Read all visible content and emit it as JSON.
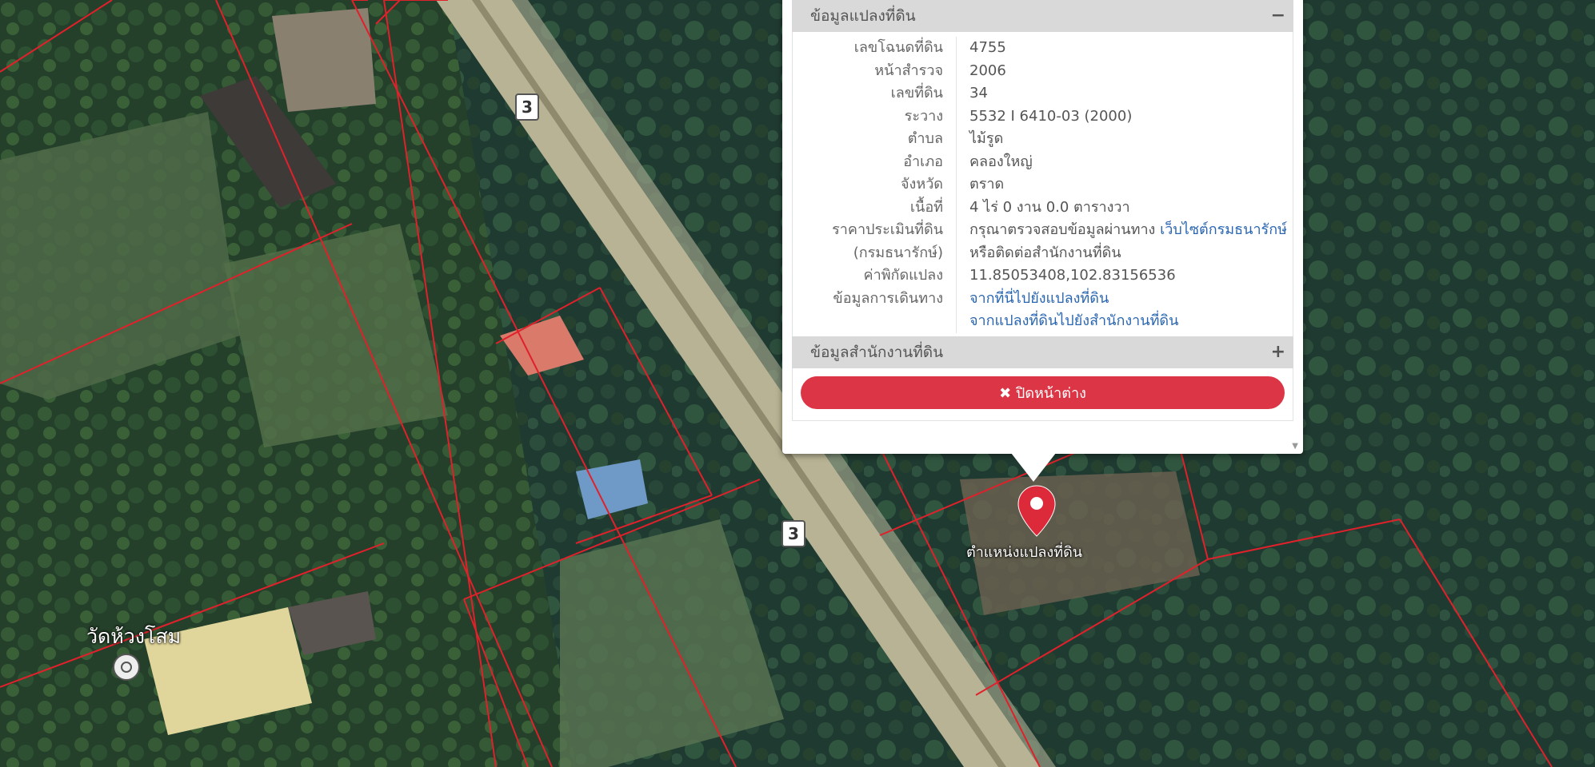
{
  "popup": {
    "section_title": "ข้อมูลแปลงที่ดิน",
    "section_toggle": "−",
    "rows": [
      {
        "label": "เลขโฉนดที่ดิน",
        "value": "4755"
      },
      {
        "label": "หน้าสำรวจ",
        "value": "2006"
      },
      {
        "label": "เลขที่ดิน",
        "value": "34"
      },
      {
        "label": "ระวาง",
        "value": "5532 I 6410-03 (2000)"
      },
      {
        "label": "ตำบล",
        "value": "ไม้รูด"
      },
      {
        "label": "อำเภอ",
        "value": "คลองใหญ่"
      },
      {
        "label": "จังหวัด",
        "value": "ตราด"
      },
      {
        "label": "เนื้อที่",
        "value": "4 ไร่ 0 งาน 0.0 ตารางวา"
      }
    ],
    "price_label_1": "ราคาประเมินที่ดิน",
    "price_label_2": "(กรมธนารักษ์)",
    "price_text": "กรุณาตรวจสอบข้อมูลผ่านทาง",
    "price_link": "เว็บไซต์กรมธนารักษ์",
    "price_text_2": "หรือติดต่อสำนักงานที่ดิน",
    "coord_label": "ค่าพิกัดแปลง",
    "coord_value": "11.85053408,102.83156536",
    "travel_label": "ข้อมูลการเดินทาง",
    "travel_link_1": "จากที่นี่ไปยังแปลงที่ดิน",
    "travel_link_2": "จากแปลงที่ดินไปยังสำนักงานที่ดิน",
    "office_title": "ข้อมูลสำนักงานที่ดิน",
    "office_toggle": "+",
    "close_label": "✖ ปิดหน้าต่าง"
  },
  "map": {
    "marker_label": "ตำแหน่งแปลงที่ดิน",
    "place_label": "วัดห้วงโสม",
    "route_shield": "3",
    "marker_color": "#dc2a3a",
    "parcel_line_color": "#e0212b"
  }
}
